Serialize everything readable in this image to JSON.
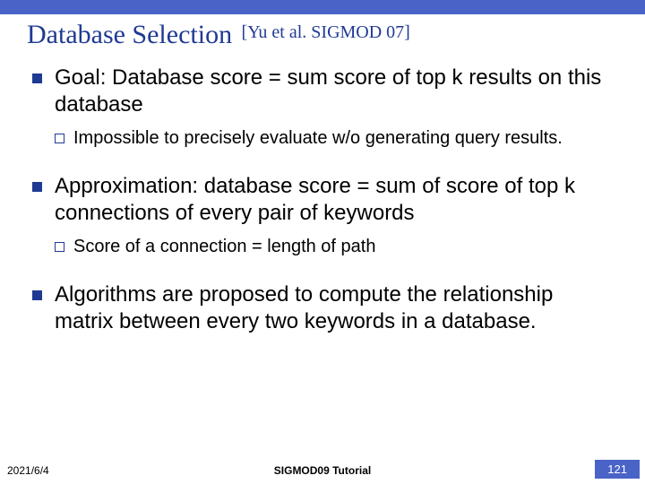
{
  "title": "Database Selection",
  "citation": "[Yu et al. SIGMOD 07]",
  "bullets": [
    {
      "text": "Goal: Database score = sum score of top k results on this database",
      "sub": [
        {
          "text": "Impossible to precisely evaluate w/o generating query results."
        }
      ]
    },
    {
      "text": "Approximation: database score = sum of score of top k connections of every pair of keywords",
      "sub": [
        {
          "text": "Score of a connection = length of path"
        }
      ]
    },
    {
      "text": "Algorithms are proposed to compute the relationship matrix between every two keywords in a database.",
      "sub": []
    }
  ],
  "footer": {
    "date": "2021/6/4",
    "center": "SIGMOD09 Tutorial",
    "slide_number": "121"
  }
}
